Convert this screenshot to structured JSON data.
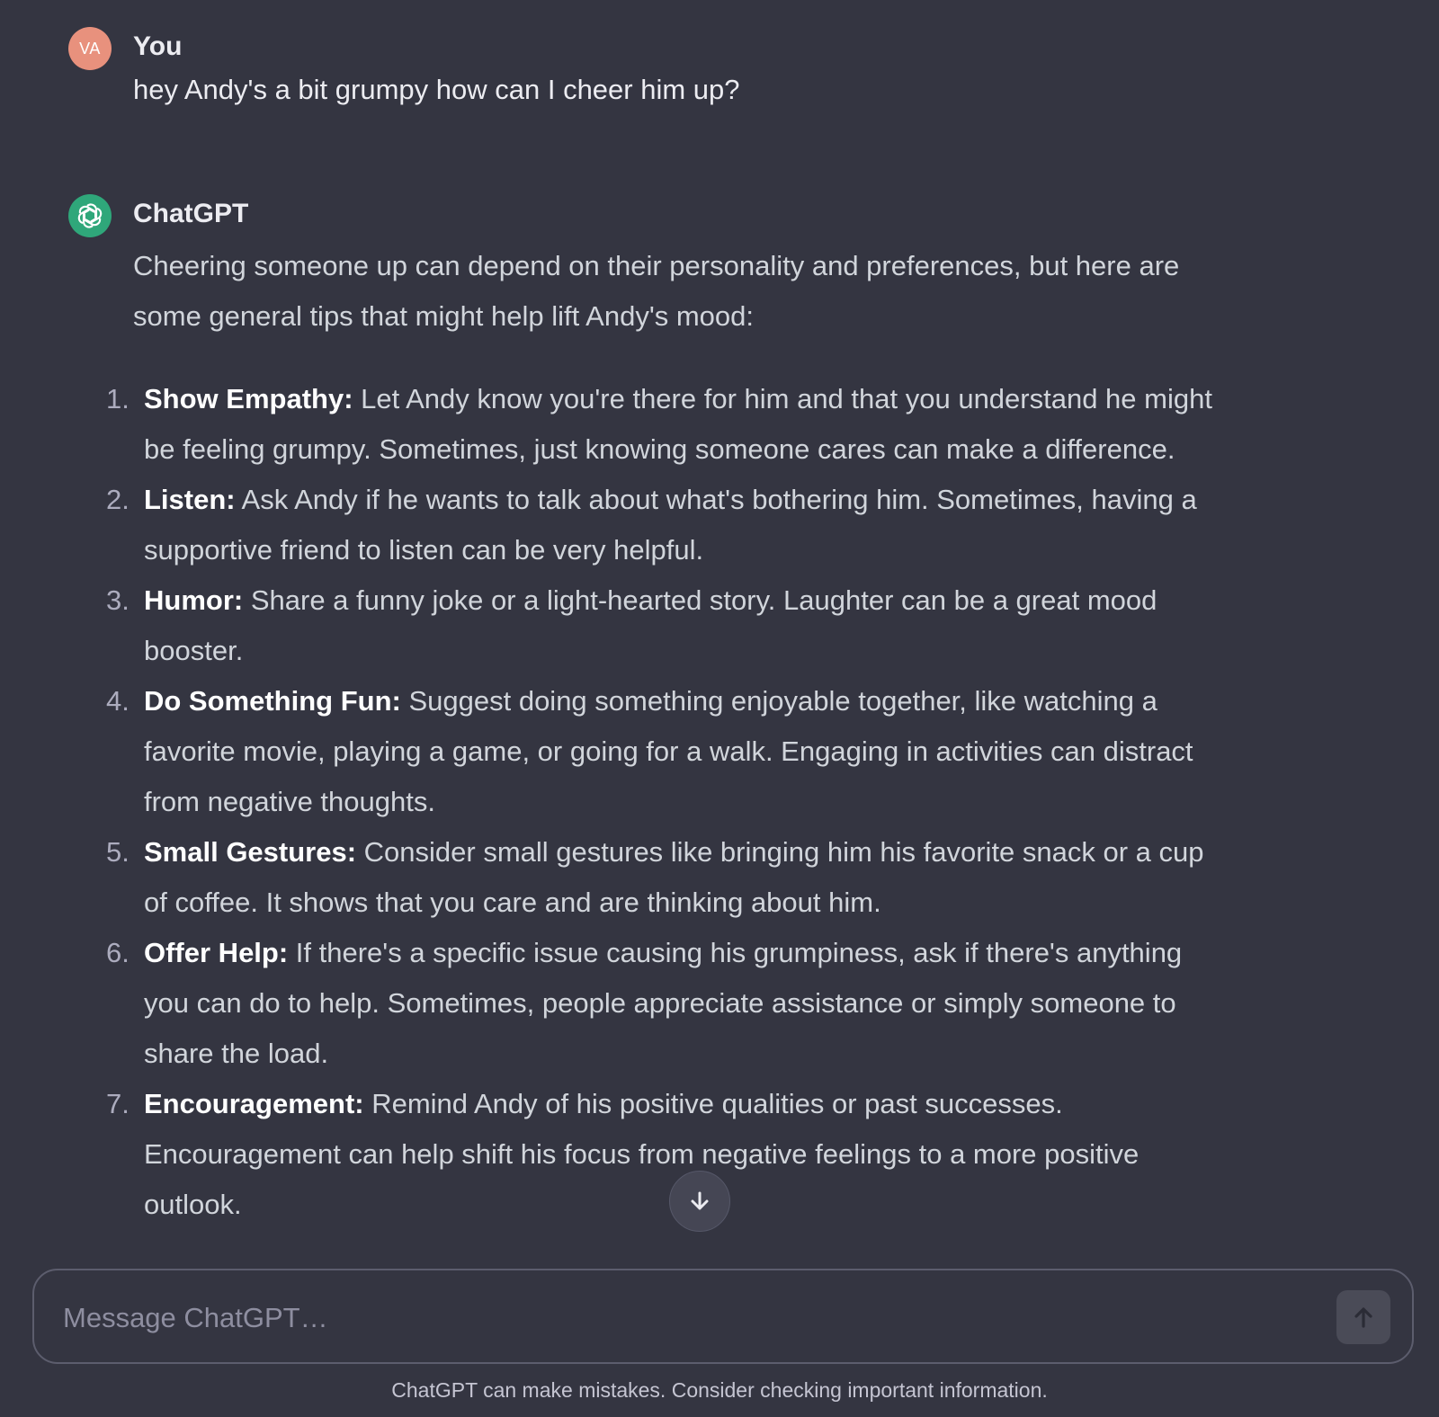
{
  "colors": {
    "background": "#343541",
    "user_avatar": "#e8917d",
    "assistant_avatar": "#2fa77a"
  },
  "user_message": {
    "avatar_initials": "VA",
    "author": "You",
    "text": "hey Andy's a bit grumpy how can I cheer him up?"
  },
  "assistant_message": {
    "avatar_icon": "openai-logo-icon",
    "author": "ChatGPT",
    "intro": "Cheering someone up can depend on their personality and preferences, but here are some general tips that might help lift Andy's mood:",
    "items": [
      {
        "num": "1.",
        "title": "Show Empathy:",
        "text": " Let Andy know you're there for him and that you understand he might be feeling grumpy. Sometimes, just knowing someone cares can make a difference."
      },
      {
        "num": "2.",
        "title": "Listen:",
        "text": " Ask Andy if he wants to talk about what's bothering him. Sometimes, having a supportive friend to listen can be very helpful."
      },
      {
        "num": "3.",
        "title": "Humor:",
        "text": " Share a funny joke or a light-hearted story. Laughter can be a great mood booster."
      },
      {
        "num": "4.",
        "title": "Do Something Fun:",
        "text": " Suggest doing something enjoyable together, like watching a favorite movie, playing a game, or going for a walk. Engaging in activities can distract from negative thoughts."
      },
      {
        "num": "5.",
        "title": "Small Gestures:",
        "text": " Consider small gestures like bringing him his favorite snack or a cup of coffee. It shows that you care and are thinking about him."
      },
      {
        "num": "6.",
        "title": "Offer Help:",
        "text": " If there's a specific issue causing his grumpiness, ask if there's anything you can do to help. Sometimes, people appreciate assistance or simply someone to share the load."
      },
      {
        "num": "7.",
        "title": "Encouragement:",
        "text": " Remind Andy of his positive qualities or past successes. Encouragement can help shift his focus from negative feelings to a more positive outlook."
      }
    ]
  },
  "scroll_button": {
    "icon": "arrow-down-icon"
  },
  "composer": {
    "placeholder": "Message ChatGPT…",
    "value": "",
    "send_icon": "arrow-up-icon"
  },
  "disclaimer": "ChatGPT can make mistakes. Consider checking important information."
}
